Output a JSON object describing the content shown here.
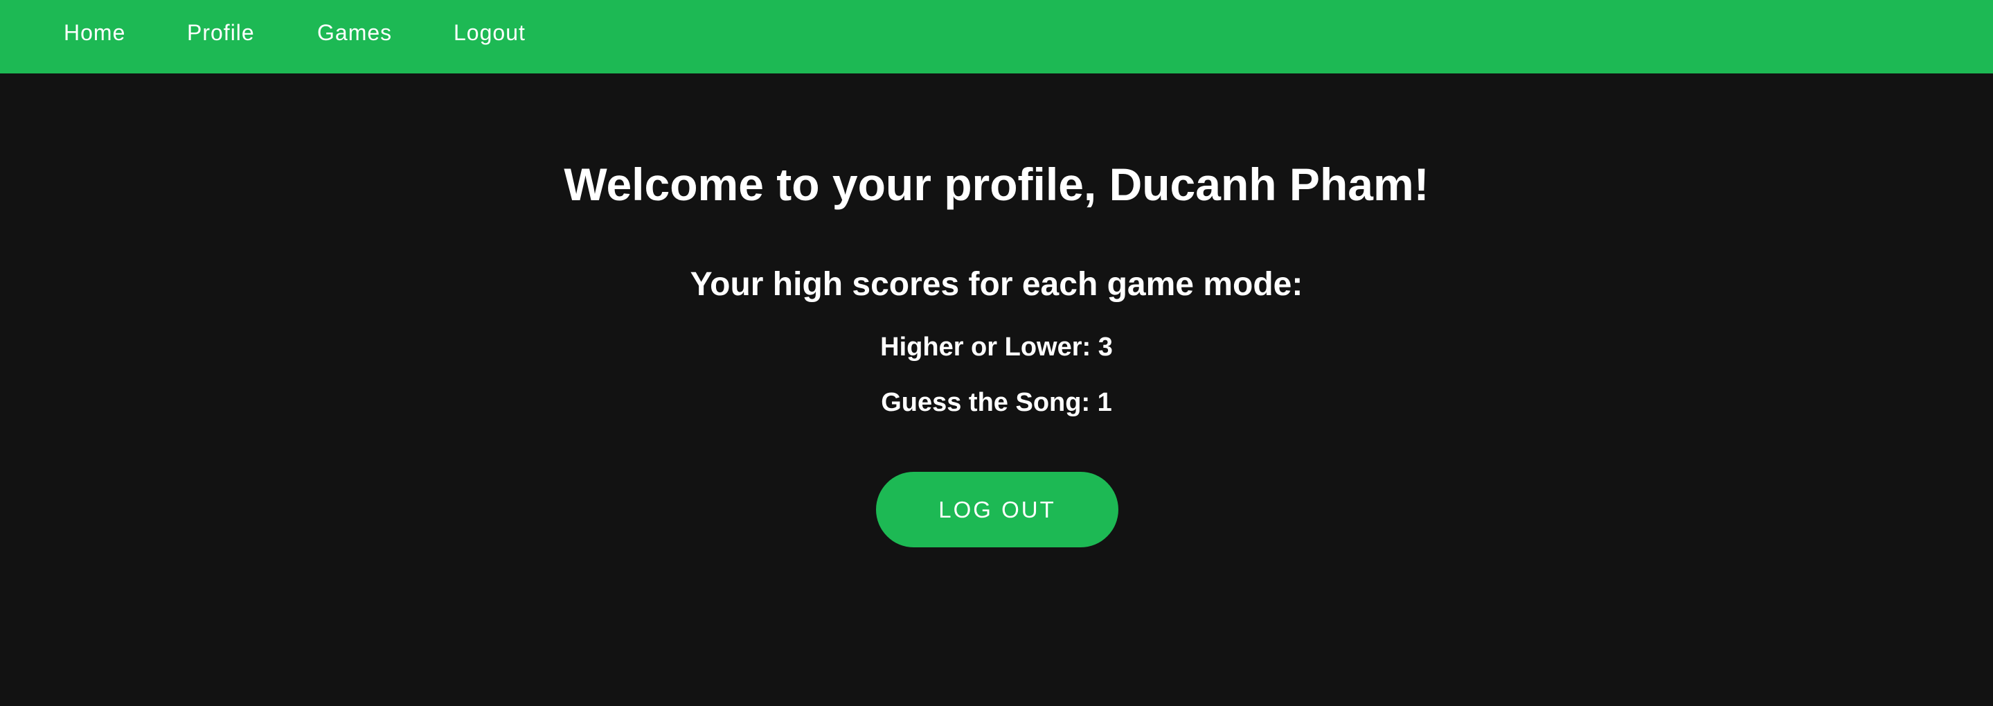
{
  "nav": {
    "items": [
      {
        "label": "Home"
      },
      {
        "label": "Profile"
      },
      {
        "label": "Games"
      },
      {
        "label": "Logout"
      }
    ]
  },
  "main": {
    "title": "Welcome to your profile, Ducanh Pham!",
    "scores_heading": "Your high scores for each game mode:",
    "scores": [
      {
        "text": "Higher or Lower: 3"
      },
      {
        "text": "Guess the Song: 1"
      }
    ],
    "logout_button_label": "LOG OUT"
  },
  "colors": {
    "accent": "#1db954",
    "background": "#121212",
    "text": "#ffffff"
  }
}
